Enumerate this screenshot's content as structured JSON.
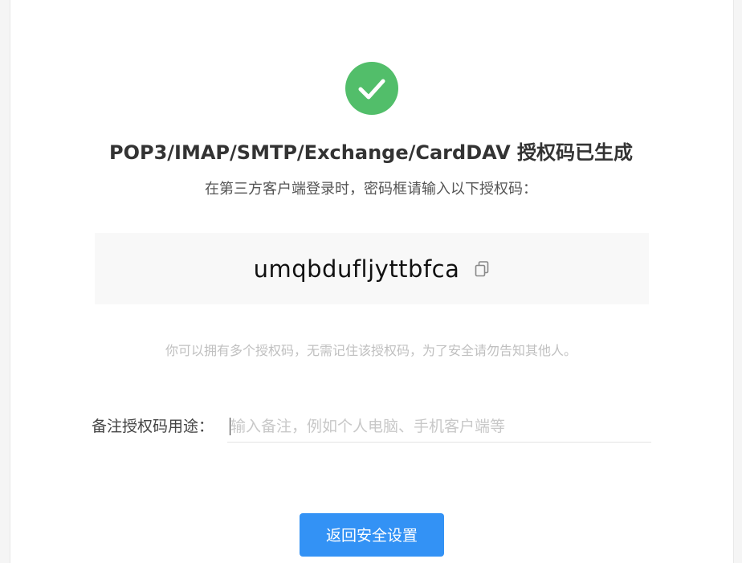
{
  "status_icon": "check-circle-icon",
  "title": "POP3/IMAP/SMTP/Exchange/CardDAV 授权码已生成",
  "subtitle": "在第三方客户端登录时，密码框请输入以下授权码：",
  "auth_code": {
    "value": "umqbdufljyttbfca",
    "copy_icon": "copy-icon"
  },
  "hint": "你可以拥有多个授权码，无需记住该授权码，为了安全请勿告知其他人。",
  "note": {
    "label": "备注授权码用途：",
    "value": "",
    "placeholder": "输入备注，例如个人电脑、手机客户端等"
  },
  "back_button_label": "返回安全设置",
  "colors": {
    "success": "#52be6a",
    "primary": "#3392f5"
  }
}
